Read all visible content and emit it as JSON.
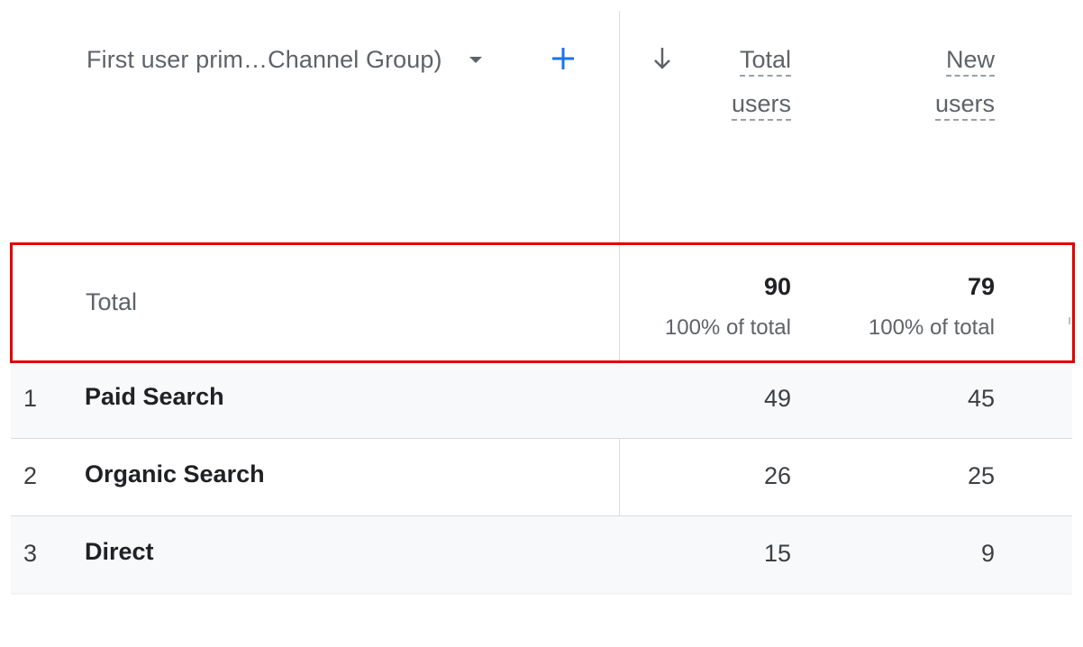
{
  "header": {
    "dimension_label": "First user prim…Channel Group)",
    "metrics": [
      {
        "line1": "Total",
        "line2": "users"
      },
      {
        "line1": "New",
        "line2": "users"
      }
    ]
  },
  "icons": {
    "dropdown": "chevron-down-icon",
    "add": "plus-icon",
    "sort": "arrow-down-icon",
    "accent_color": "#1a73e8",
    "highlight_color": "#e00000"
  },
  "total_row": {
    "label": "Total",
    "total_users": "90",
    "total_users_pct": "100% of total",
    "new_users": "79",
    "new_users_pct": "100% of total"
  },
  "rows": [
    {
      "index": "1",
      "channel": "Paid Search",
      "total_users": "49",
      "new_users": "45"
    },
    {
      "index": "2",
      "channel": "Organic Search",
      "total_users": "26",
      "new_users": "25"
    },
    {
      "index": "3",
      "channel": "Direct",
      "total_users": "15",
      "new_users": "9"
    }
  ]
}
